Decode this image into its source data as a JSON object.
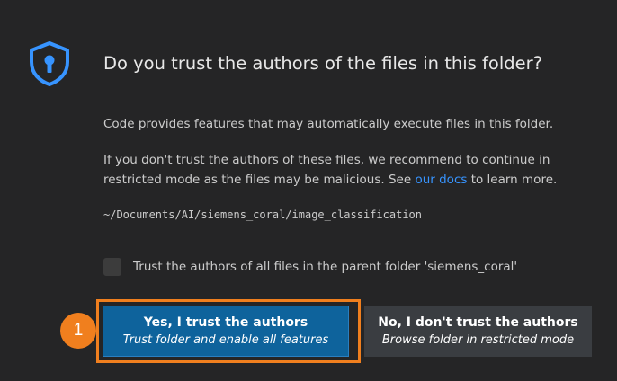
{
  "dialog": {
    "title": "Do you trust the authors of the files in this folder?",
    "paragraph1": "Code provides features that may automatically execute files in this folder.",
    "paragraph2": {
      "line1": "If you don't trust the authors of these files, we recommend to continue in",
      "line2_before": "restricted mode as the files may be malicious. See ",
      "link_text": "our docs",
      "line2_after": " to learn more."
    },
    "folder_path": "~/Documents/AI/siemens_coral/image_classification",
    "checkbox": {
      "label": "Trust the authors of all files in the parent folder 'siemens_coral'",
      "checked": false
    },
    "buttons": {
      "trust": {
        "title": "Yes, I trust the authors",
        "subtitle": "Trust folder and enable all features"
      },
      "no_trust": {
        "title": "No, I don't trust the authors",
        "subtitle": "Browse folder in restricted mode"
      }
    }
  },
  "annotation": {
    "step_number": "1",
    "color": "#f07f1e"
  },
  "colors": {
    "background": "#252526",
    "accent_blue": "#0e639c",
    "link": "#3794ff",
    "icon": "#3794ff"
  },
  "icons": {
    "shield": "shield-lock-icon"
  }
}
